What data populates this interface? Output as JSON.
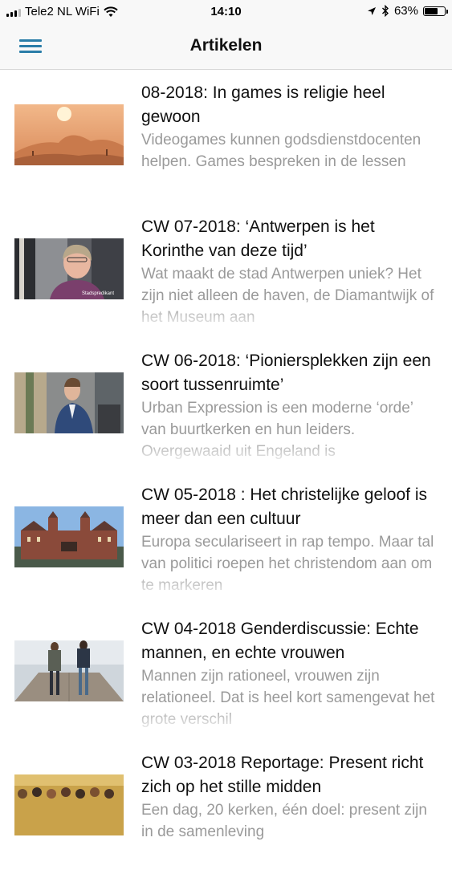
{
  "status": {
    "carrier": "Tele2 NL WiFi",
    "time": "14:10",
    "battery": "63%"
  },
  "nav": {
    "title": "Artikelen"
  },
  "articles": [
    {
      "title": "08-2018: In games is religie heel gewoon",
      "excerpt": "Videogames kunnen godsdienstdocenten helpen. Games bespreken in de lessen",
      "image": "desert-game-landscape"
    },
    {
      "title": "CW 07-2018: ‘Antwerpen is het Korinthe van deze tijd’",
      "excerpt": "Wat maakt de stad Antwerpen uniek? Het zijn niet alleen de haven, de Diamantwijk of het Museum aan",
      "image": "woman-portrait",
      "image_caption": "Stadspredikant"
    },
    {
      "title": "CW 06-2018: ‘Pioniersplekken zijn een soort tussenruimte’",
      "excerpt": "Urban Expression is een moderne ‘orde’ van buurtkerken en hun leiders. Overgewaaid uit Engeland is",
      "image": "man-portrait-street"
    },
    {
      "title": "CW 05-2018 : Het christelijke geloof is meer dan een cultuur",
      "excerpt": "Europa seculariseert in rap tempo. Maar tal van politici roepen het christendom aan om te markeren",
      "image": "museum-building"
    },
    {
      "title": "CW 04-2018 Genderdiscussie: Echte mannen, en echte vrouwen",
      "excerpt": "Mannen zijn rationeel, vrouwen zijn relationeel. Dat is heel kort samengevat het grote verschil",
      "image": "couple-on-pier"
    },
    {
      "title": "CW 03-2018 Reportage: Present richt zich op het stille midden",
      "excerpt": "Een dag, 20 kerken, één doel: present zijn in de samenleving",
      "image": "crowd-event"
    }
  ]
}
